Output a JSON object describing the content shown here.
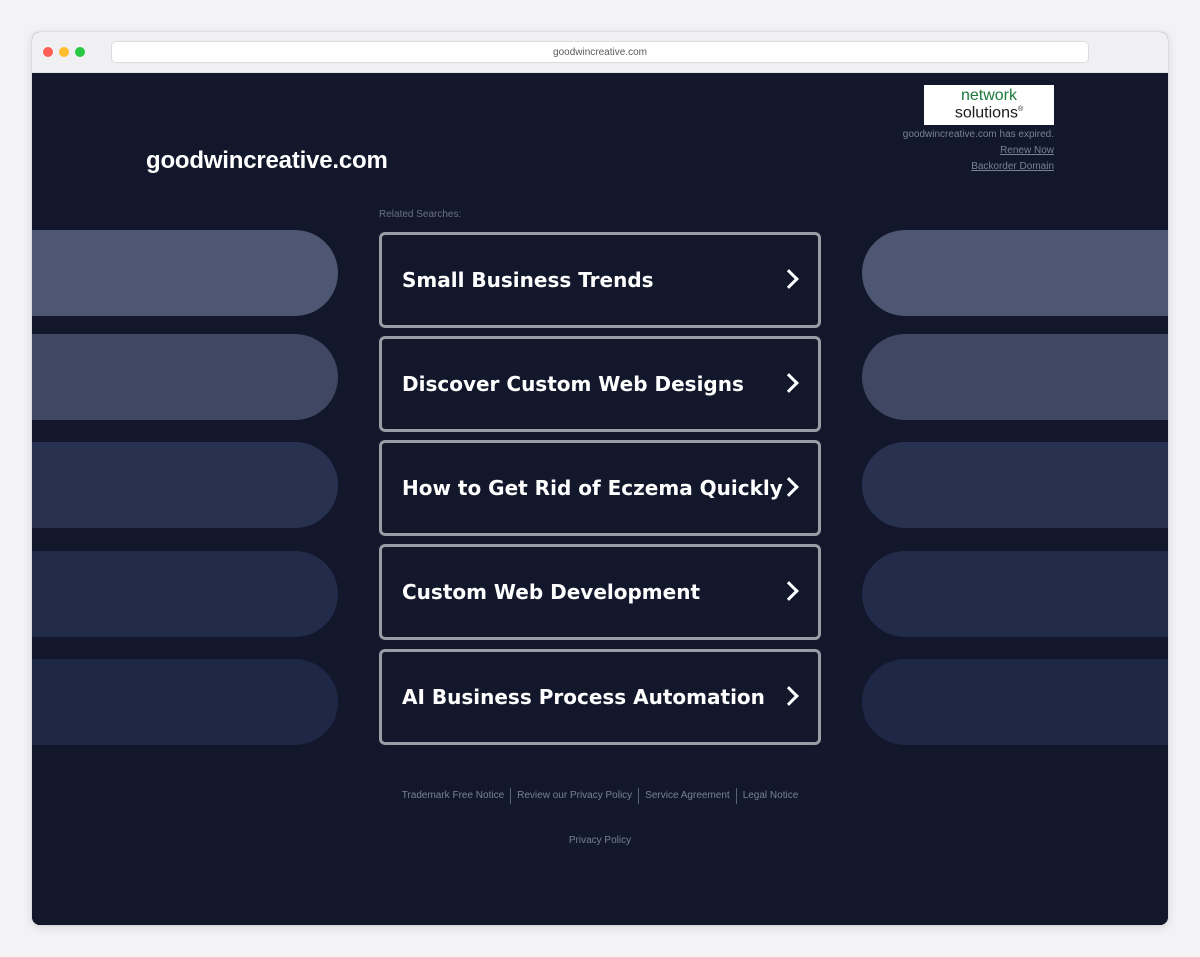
{
  "browser": {
    "url": "goodwincreative.com"
  },
  "header": {
    "site_title": "goodwincreative.com",
    "logo_line1": "network",
    "logo_line2": "solutions",
    "logo_mark": "®",
    "expired_text": "goodwincreative.com has expired.",
    "renew_link": "Renew Now",
    "backorder_link": "Backorder Domain"
  },
  "main": {
    "related_label": "Related Searches:",
    "searches": [
      "Small Business Trends",
      "Discover Custom Web Designs",
      "How to Get Rid of Eczema Quickly",
      "Custom Web Development",
      "AI Business Process Automation"
    ]
  },
  "footer": {
    "links": [
      "Trademark Free Notice",
      "Review our Privacy Policy",
      "Service Agreement",
      "Legal Notice"
    ],
    "privacy": "Privacy Policy"
  },
  "colors": {
    "background": "#12172b",
    "pill_shades": [
      "#4d5672",
      "#3f4763",
      "#283150",
      "#222b4a",
      "#1e2746"
    ],
    "button_border": "#9a9ca6",
    "logo_green": "#1c7a3a"
  },
  "icons": {
    "chevron": "chevron-right-icon"
  }
}
